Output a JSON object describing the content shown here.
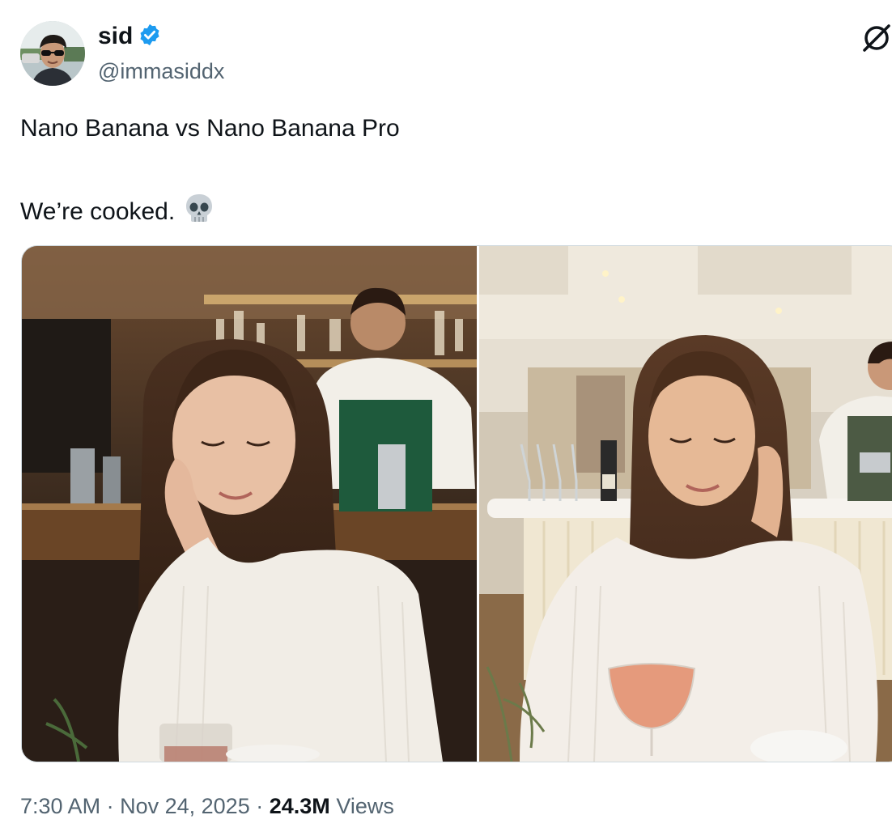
{
  "author": {
    "display_name": "sid",
    "handle": "@immasiddx",
    "verified": true,
    "verified_color": "#1d9bf0"
  },
  "tweet": {
    "line1": "Nano Banana vs Nano Banana Pro",
    "line2": "We’re cooked.",
    "emoji_icon": "skull-icon"
  },
  "media": [
    {
      "alt": "Nano Banana image: woman with eyes closed resting cheek on hand at a bar, bartender in green apron behind"
    },
    {
      "alt": "Nano Banana Pro image: woman with eyes closed resting cheek on hand at a bright bar, bartender pouring behind, cocktail in front"
    }
  ],
  "meta": {
    "time": "7:30 AM",
    "separator": "·",
    "date": "Nov 24, 2025",
    "views_count": "24.3M",
    "views_label": "Views"
  },
  "icons": {
    "grok": "grok-icon",
    "verified": "verified-badge-icon",
    "avatar": "avatar"
  }
}
